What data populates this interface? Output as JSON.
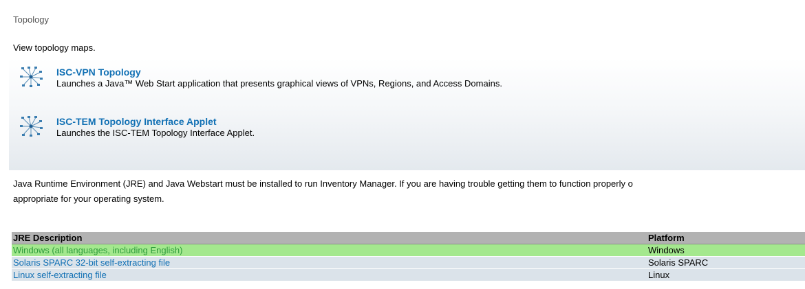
{
  "section": {
    "title": "Topology",
    "intro": "View topology maps."
  },
  "tools": [
    {
      "name": "ISC-VPN Topology",
      "description": "Launches a Java™ Web Start application that presents graphical views of VPNs, Regions, and Access Domains.",
      "icon": "topology-network-icon"
    },
    {
      "name": "ISC-TEM Topology Interface Applet",
      "description": "Launches the ISC-TEM Topology Interface Applet.",
      "icon": "topology-network-icon"
    }
  ],
  "note": {
    "line1": "Java Runtime Environment (JRE) and Java Webstart must be installed to run Inventory Manager. If you are having trouble getting them to function properly o",
    "line2": "appropriate for your operating system."
  },
  "table": {
    "headers": [
      "JRE Description",
      "Platform"
    ],
    "rows": [
      {
        "description": "Windows (all languages, including English)",
        "platform": "Windows",
        "selected": true
      },
      {
        "description": "Solaris SPARC 32-bit self-extracting file",
        "platform": "Solaris SPARC",
        "selected": false
      },
      {
        "description": "Linux self-extracting file",
        "platform": "Linux",
        "selected": false
      }
    ]
  },
  "colors": {
    "link": "#1170b4",
    "selected_row": "#a4e88e",
    "row": "#dbe3ea",
    "header": "#b2b2b2"
  }
}
